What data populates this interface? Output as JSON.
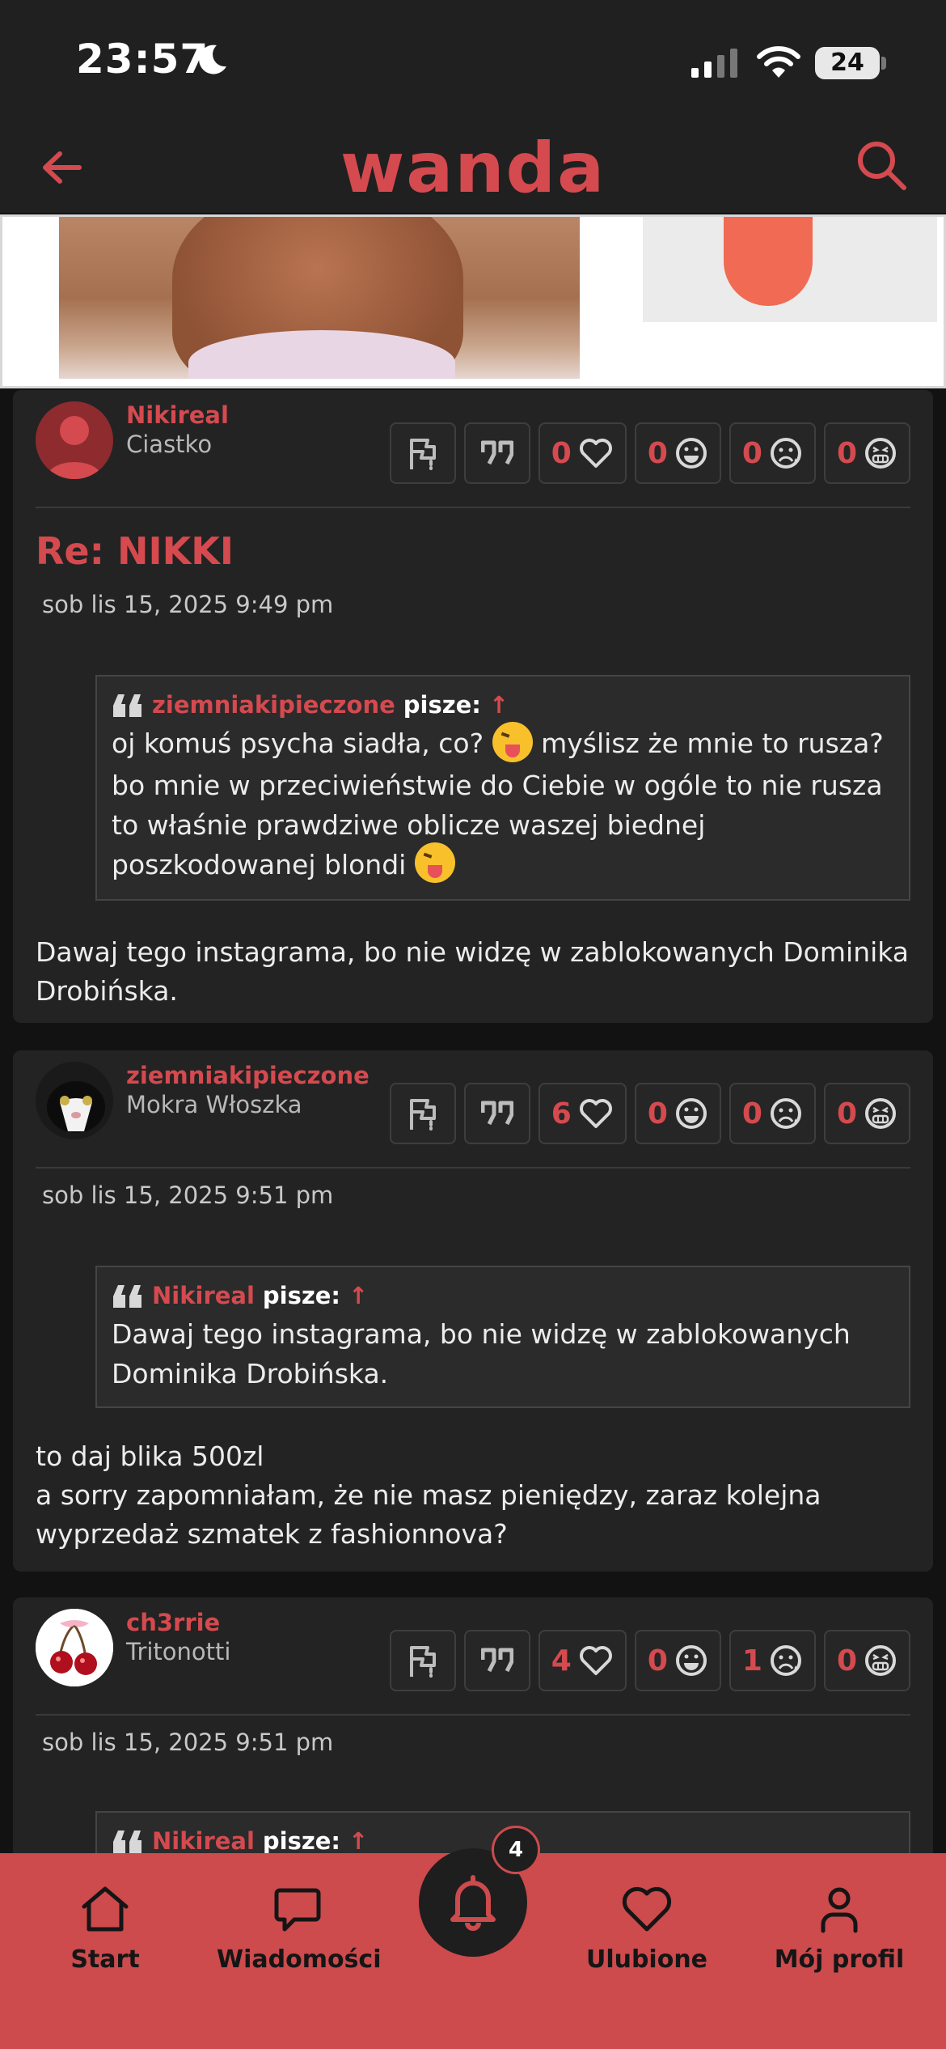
{
  "status_bar": {
    "time": "23:57",
    "battery": "24"
  },
  "header": {
    "logo": "wanda"
  },
  "quote_says": "pisze:",
  "quote_arrow": "↑",
  "posts": [
    {
      "username": "Nikireal",
      "rank": "Ciastko",
      "counts": {
        "like": "0",
        "laugh": "0",
        "sad": "0",
        "angry": "0"
      },
      "title": "Re: NIKKI",
      "date": "sob lis 15, 2025 9:49 pm",
      "quote_author": "ziemniakipieczone",
      "quote_part1": "oj komuś psycha siadła, co?",
      "quote_part2": "myślisz że mnie to rusza? bo mnie w przeciwieństwie do Ciebie w ogóle to nie rusza to właśnie prawdziwe oblicze waszej biednej poszkodowanej blondi",
      "text": "Dawaj tego instagrama, bo nie widzę w zablokowanych Dominika Drobińska."
    },
    {
      "username": "ziemniakipieczone",
      "rank": "Mokra Włoszka",
      "counts": {
        "like": "6",
        "laugh": "0",
        "sad": "0",
        "angry": "0"
      },
      "date": "sob lis 15, 2025 9:51 pm",
      "quote_author": "Nikireal",
      "quote_text": "Dawaj tego instagrama, bo nie widzę w zablokowanych Dominika Drobińska.",
      "text_line1": "to daj blika 500zl",
      "text_line2": "a sorry zapomniałam, że nie masz pieniędzy, zaraz kolejna wyprzedaż szmatek z fashionnova?"
    },
    {
      "username": "ch3rrie",
      "rank": "Tritonotti",
      "counts": {
        "like": "4",
        "laugh": "0",
        "sad": "1",
        "angry": "0"
      },
      "date": "sob lis 15, 2025 9:51 pm",
      "quote_author": "Nikireal"
    }
  ],
  "tabbar": {
    "start": "Start",
    "messages": "Wiadomości",
    "notifications_badge": "4",
    "favorites": "Ulubione",
    "profile": "Mój profil"
  },
  "colors": {
    "accent": "#d44a4f",
    "background": "#121212",
    "card": "#232323",
    "tabbar": "#cd4a4d"
  }
}
